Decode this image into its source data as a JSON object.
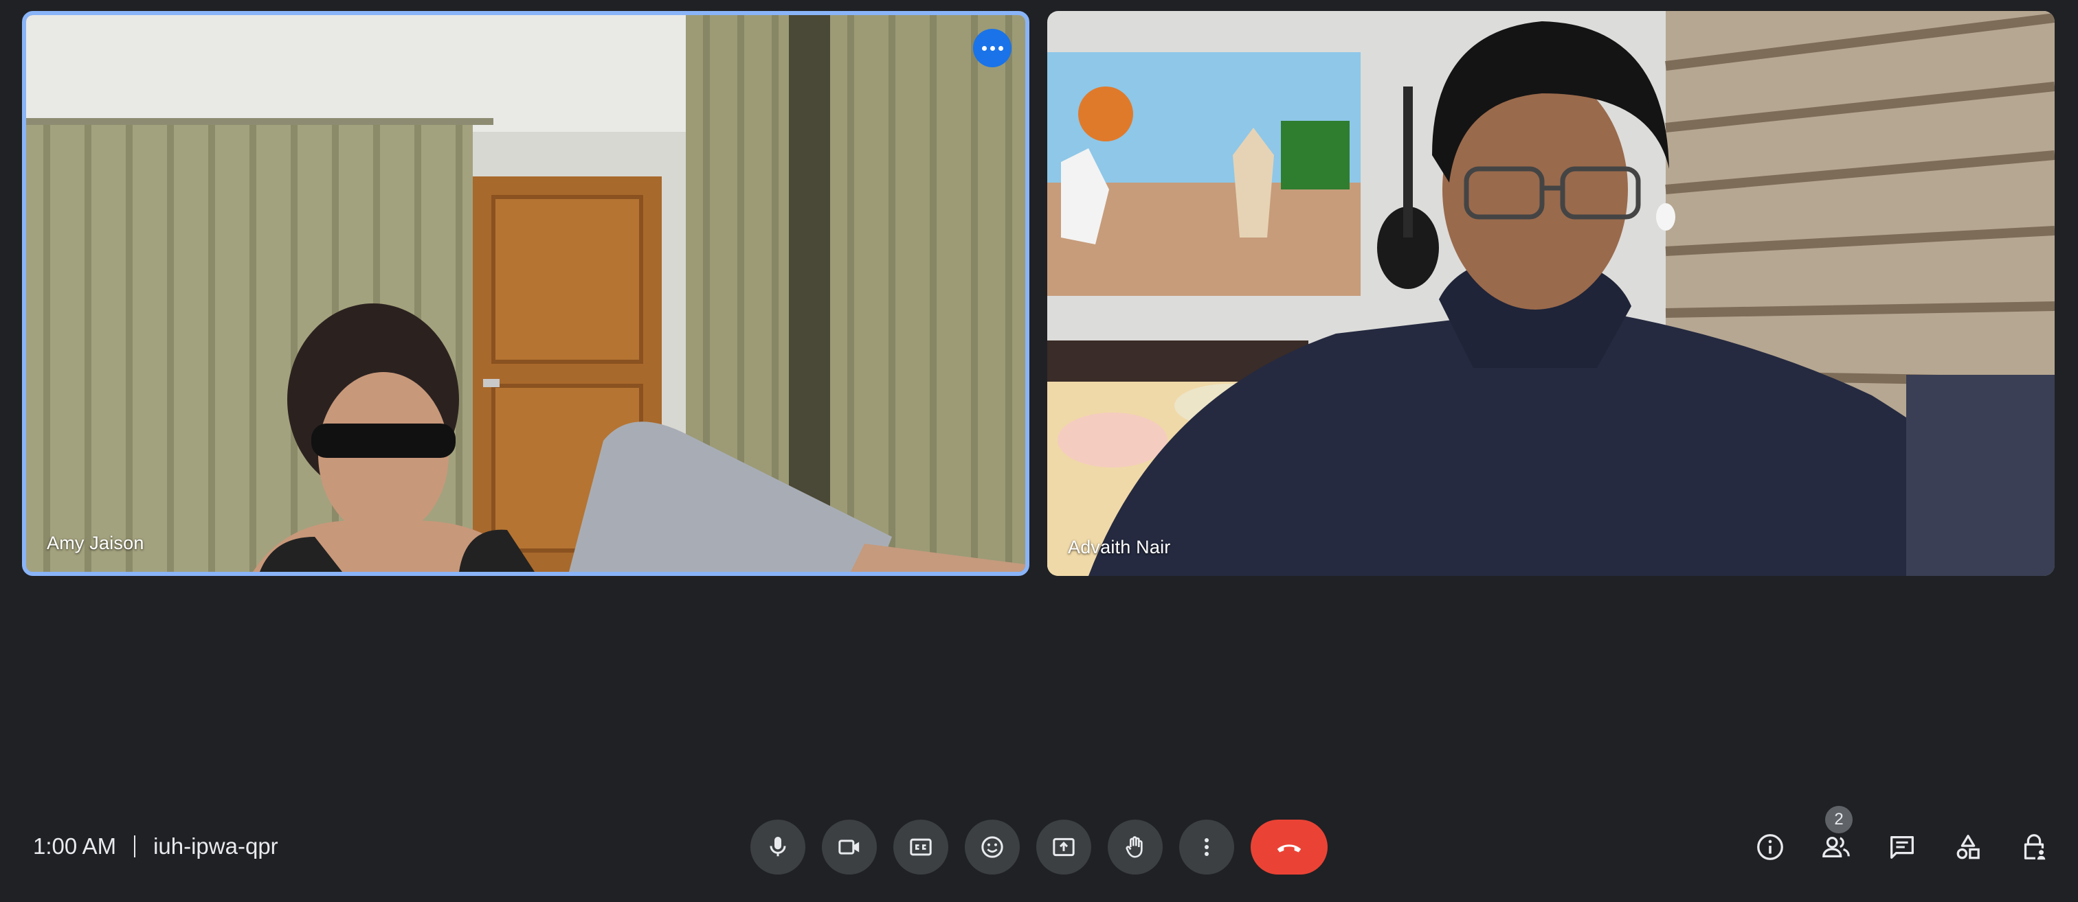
{
  "participants": [
    {
      "name": "Amy Jaison",
      "active_speaker": true
    },
    {
      "name": "Advaith Nair",
      "active_speaker": false
    }
  ],
  "tile_menu_icon": "more-horiz-icon",
  "meeting": {
    "time": "1:00 AM",
    "code": "iuh-ipwa-qpr"
  },
  "controls": [
    {
      "name": "microphone",
      "icon": "mic-icon"
    },
    {
      "name": "camera",
      "icon": "videocam-icon"
    },
    {
      "name": "captions",
      "icon": "closed-caption-icon"
    },
    {
      "name": "reactions",
      "icon": "emoji-icon"
    },
    {
      "name": "present",
      "icon": "present-screen-icon"
    },
    {
      "name": "raise-hand",
      "icon": "hand-icon"
    },
    {
      "name": "more-options",
      "icon": "more-vert-icon"
    },
    {
      "name": "leave-call",
      "icon": "call-end-icon"
    }
  ],
  "side_controls": {
    "info_icon": "info-icon",
    "people_icon": "people-icon",
    "people_count": "2",
    "chat_icon": "chat-icon",
    "activities_icon": "shapes-icon",
    "host_controls_icon": "lock-person-icon"
  },
  "colors": {
    "background": "#202124",
    "control": "#3c4043",
    "end_call": "#ea4335",
    "active_border": "#8ab4f8",
    "tile_menu": "#1a73e8"
  }
}
